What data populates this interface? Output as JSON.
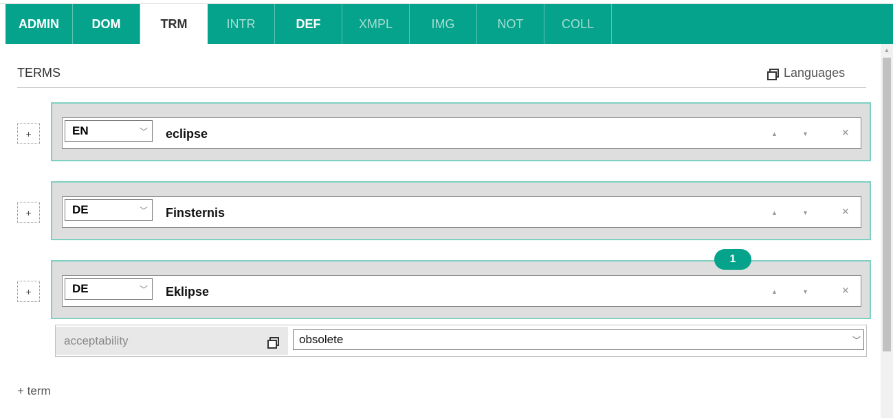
{
  "tabs": [
    {
      "label": "ADMIN",
      "state": "enabled"
    },
    {
      "label": "DOM",
      "state": "enabled"
    },
    {
      "label": "TRM",
      "state": "selected"
    },
    {
      "label": "INTR",
      "state": "disabled"
    },
    {
      "label": "DEF",
      "state": "enabled"
    },
    {
      "label": "XMPL",
      "state": "disabled"
    },
    {
      "label": "IMG",
      "state": "disabled"
    },
    {
      "label": "NOT",
      "state": "disabled"
    },
    {
      "label": "COLL",
      "state": "disabled"
    }
  ],
  "section": {
    "title": "TERMS",
    "languages_label": "Languages",
    "languages_icon": "window-icon"
  },
  "terms": [
    {
      "lang": "EN",
      "text": "eclipse"
    },
    {
      "lang": "DE",
      "text": "Finsternis"
    },
    {
      "lang": "DE",
      "text": "Eklipse"
    }
  ],
  "term_controls": {
    "plus": "+",
    "up": "▲",
    "down": "▼",
    "remove": "✕",
    "chevron": "﹀"
  },
  "badge": {
    "count": "1"
  },
  "acceptability": {
    "label": "acceptability",
    "value": "obsolete",
    "icon": "window-icon"
  },
  "add_term_label": "+ term",
  "colors": {
    "accent": "#05a38c",
    "term_border": "#7fd0c2",
    "term_bg": "#dedede"
  }
}
